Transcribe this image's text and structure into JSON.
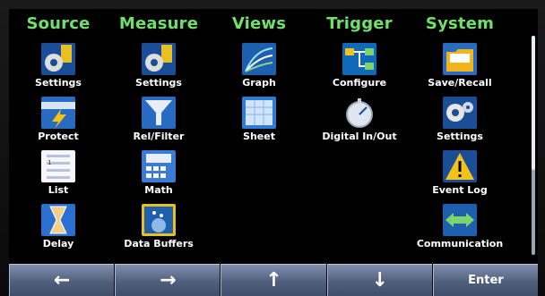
{
  "columns": [
    {
      "title": "Source",
      "tiles": [
        {
          "label": "Settings",
          "icon": "source-settings-icon"
        },
        {
          "label": "Protect",
          "icon": "protect-icon"
        },
        {
          "label": "List",
          "icon": "list-icon"
        },
        {
          "label": "Delay",
          "icon": "hourglass-icon"
        }
      ]
    },
    {
      "title": "Measure",
      "tiles": [
        {
          "label": "Settings",
          "icon": "measure-settings-icon"
        },
        {
          "label": "Rel/Filter",
          "icon": "filter-icon"
        },
        {
          "label": "Math",
          "icon": "calculator-icon"
        },
        {
          "label": "Data Buffers",
          "icon": "data-buffers-icon"
        }
      ]
    },
    {
      "title": "Views",
      "tiles": [
        {
          "label": "Graph",
          "icon": "graph-icon"
        },
        {
          "label": "Sheet",
          "icon": "sheet-icon"
        }
      ]
    },
    {
      "title": "Trigger",
      "tiles": [
        {
          "label": "Configure",
          "icon": "trigger-configure-icon"
        },
        {
          "label": "Digital In/Out",
          "icon": "digital-io-icon"
        }
      ]
    },
    {
      "title": "System",
      "tiles": [
        {
          "label": "Save/Recall",
          "icon": "folder-icon"
        },
        {
          "label": "Settings",
          "icon": "system-settings-icon"
        },
        {
          "label": "Event Log",
          "icon": "warning-icon"
        },
        {
          "label": "Communication",
          "icon": "communication-icon"
        }
      ]
    }
  ],
  "softkeys": {
    "left": "←",
    "right": "→",
    "up": "↑",
    "down": "↓",
    "enter": "Enter"
  },
  "colors": {
    "header_green": "#6fe06a",
    "softkey_blue": "#5a6a88",
    "icon_blue": "#1f6fc0"
  }
}
